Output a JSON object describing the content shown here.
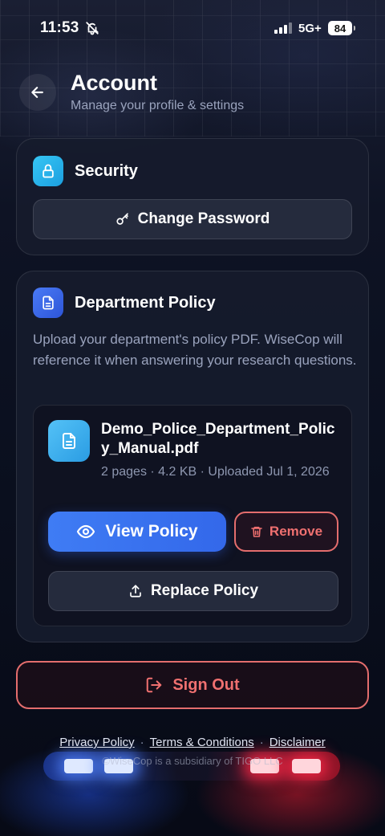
{
  "status_bar": {
    "time": "11:53",
    "network": "5G+",
    "battery": "84"
  },
  "header": {
    "title": "Account",
    "subtitle": "Manage your profile & settings"
  },
  "security": {
    "title": "Security",
    "change_password_label": "Change Password"
  },
  "policy": {
    "title": "Department Policy",
    "description": "Upload your department's policy PDF. WiseCop will reference it when answering your research questions.",
    "file": {
      "name": "Demo_Police_Department_Policy_Manual.pdf",
      "meta": "2 pages · 4.2 KB · Uploaded Jul 1, 2026"
    },
    "view_label": "View Policy",
    "remove_label": "Remove",
    "replace_label": "Replace Policy"
  },
  "sign_out_label": "Sign Out",
  "footer": {
    "links": [
      "Privacy Policy",
      "Terms & Conditions",
      "Disclaimer"
    ],
    "separator": "·",
    "copyright": "©WiseCop is a subsidiary of TIGO LLC"
  },
  "colors": {
    "accent_blue": "#3f7cf4",
    "danger": "#ef7070",
    "badge_cyan": "#36c6f4"
  }
}
